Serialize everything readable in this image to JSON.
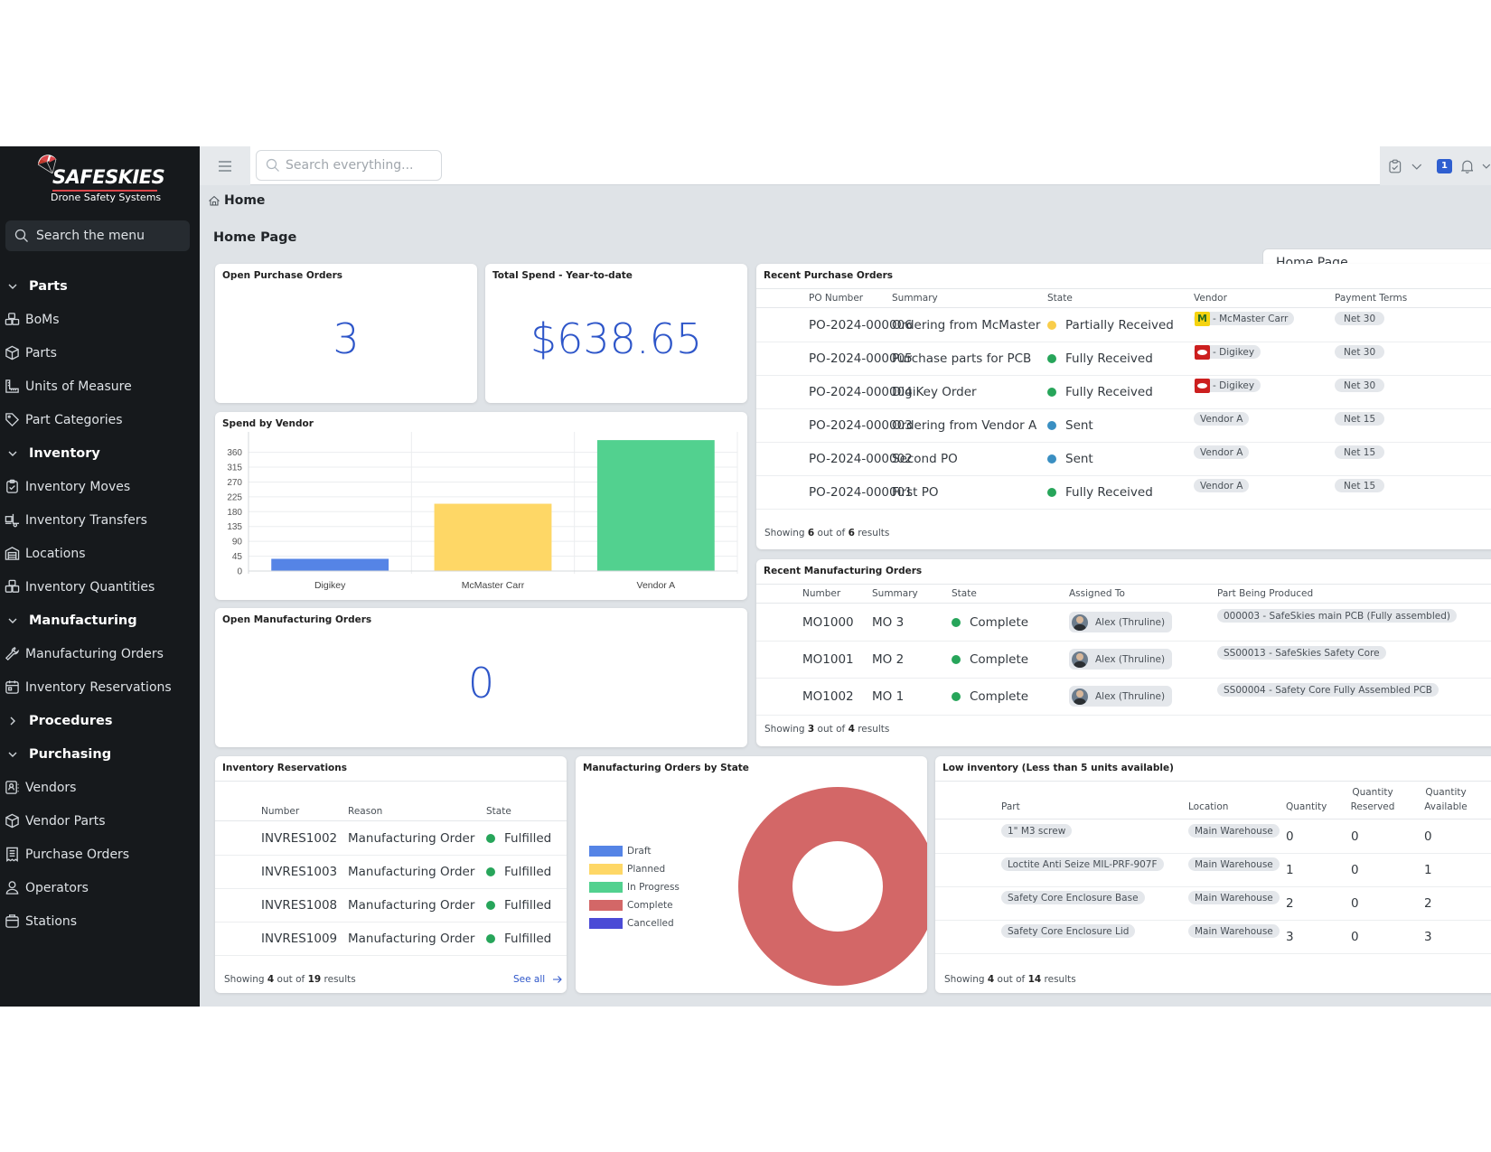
{
  "sidebar": {
    "brand_name": "SAFESKIES",
    "brand_tagline": "Drone Safety Systems",
    "search_placeholder": "Search the menu",
    "groups": [
      {
        "label": "Parts",
        "expanded": true,
        "items": [
          {
            "label": "BoMs",
            "icon": "boxes-icon"
          },
          {
            "label": "Parts",
            "icon": "cube-icon"
          },
          {
            "label": "Units of Measure",
            "icon": "ruler-icon"
          },
          {
            "label": "Part Categories",
            "icon": "tag-icon"
          }
        ]
      },
      {
        "label": "Inventory",
        "expanded": true,
        "items": [
          {
            "label": "Inventory Moves",
            "icon": "clipboard-check-icon"
          },
          {
            "label": "Inventory Transfers",
            "icon": "dolly-icon"
          },
          {
            "label": "Locations",
            "icon": "warehouse-icon"
          },
          {
            "label": "Inventory Quantities",
            "icon": "packages-icon"
          }
        ]
      },
      {
        "label": "Manufacturing",
        "expanded": true,
        "items": [
          {
            "label": "Manufacturing Orders",
            "icon": "wrench-icon"
          },
          {
            "label": "Inventory Reservations",
            "icon": "calendar-icon"
          }
        ]
      },
      {
        "label": "Procedures",
        "expanded": false,
        "items": []
      },
      {
        "label": "Purchasing",
        "expanded": true,
        "items": [
          {
            "label": "Vendors",
            "icon": "contact-book-icon"
          },
          {
            "label": "Vendor Parts",
            "icon": "cube-icon"
          },
          {
            "label": "Purchase Orders",
            "icon": "receipt-icon"
          },
          {
            "label": "Operators",
            "icon": "user-icon"
          },
          {
            "label": "Stations",
            "icon": "station-icon"
          }
        ]
      }
    ]
  },
  "header": {
    "search_placeholder": "Search everything...",
    "notification_count": "1"
  },
  "breadcrumb": {
    "label": "Home"
  },
  "page": {
    "title": "Home Page",
    "dashboard_select": "Home Page"
  },
  "colors": {
    "accent": "#2e56c9",
    "sidebar_bg": "#16191c",
    "state_green": "#27a55a",
    "state_yellow": "#f9cd4a",
    "state_blue": "#3a8fc2"
  },
  "kpis": {
    "open_po": {
      "title": "Open Purchase Orders",
      "value": "3"
    },
    "total_spend": {
      "title": "Total Spend - Year-to-date",
      "value": "$638.65"
    },
    "open_mo": {
      "title": "Open Manufacturing Orders",
      "value": "0"
    }
  },
  "spend_by_vendor": {
    "title": "Spend by Vendor"
  },
  "recent_pos": {
    "title": "Recent Purchase Orders",
    "columns": [
      "PO Number",
      "Summary",
      "State",
      "Vendor",
      "Payment Terms"
    ],
    "rows": [
      {
        "number": "PO-2024-000006",
        "summary": "Ordering from McMaster",
        "state": "Partially Received",
        "state_color": "#f9cd4a",
        "vendor": "- McMaster Carr",
        "vendor_logo": "mcmaster",
        "terms": "Net 30"
      },
      {
        "number": "PO-2024-000005",
        "summary": "Purchase parts for PCB",
        "state": "Fully Received",
        "state_color": "#27a55a",
        "vendor": "- Digikey",
        "vendor_logo": "digikey",
        "terms": "Net 30"
      },
      {
        "number": "PO-2024-000004",
        "summary": "DigiKey Order",
        "state": "Fully Received",
        "state_color": "#27a55a",
        "vendor": "- Digikey",
        "vendor_logo": "digikey",
        "terms": "Net 30"
      },
      {
        "number": "PO-2024-000003",
        "summary": "Ordering from Vendor A",
        "state": "Sent",
        "state_color": "#3a8fc2",
        "vendor": "Vendor A",
        "vendor_logo": "",
        "terms": "Net 15"
      },
      {
        "number": "PO-2024-000002",
        "summary": "Second PO",
        "state": "Sent",
        "state_color": "#3a8fc2",
        "vendor": "Vendor A",
        "vendor_logo": "",
        "terms": "Net 15"
      },
      {
        "number": "PO-2024-000001",
        "summary": "First PO",
        "state": "Fully Received",
        "state_color": "#27a55a",
        "vendor": "Vendor A",
        "vendor_logo": "",
        "terms": "Net 15"
      }
    ],
    "footer": {
      "prefix": "Showing ",
      "shown": "6",
      "middle": " out of ",
      "total": "6",
      "suffix": " results"
    }
  },
  "recent_mos": {
    "title": "Recent Manufacturing Orders",
    "columns": [
      "Number",
      "Summary",
      "State",
      "Assigned To",
      "Part Being Produced"
    ],
    "rows": [
      {
        "number": "MO1000",
        "summary": "MO 3",
        "state": "Complete",
        "assignee": "Alex (Thruline)",
        "part": "000003 - SafeSkies main PCB (Fully assembled)"
      },
      {
        "number": "MO1001",
        "summary": "MO 2",
        "state": "Complete",
        "assignee": "Alex (Thruline)",
        "part": "SS00013 - SafeSkies Safety Core"
      },
      {
        "number": "MO1002",
        "summary": "MO 1",
        "state": "Complete",
        "assignee": "Alex (Thruline)",
        "part": "SS00004 - Safety Core Fully Assembled PCB"
      }
    ],
    "footer": {
      "prefix": "Showing ",
      "shown": "3",
      "middle": " out of ",
      "total": "4",
      "suffix": " results"
    }
  },
  "inventory_reservations": {
    "title": "Inventory Reservations",
    "columns": [
      "Number",
      "Reason",
      "State"
    ],
    "rows": [
      {
        "number": "INVRES1002",
        "reason": "Manufacturing Order",
        "state": "Fulfilled"
      },
      {
        "number": "INVRES1003",
        "reason": "Manufacturing Order",
        "state": "Fulfilled"
      },
      {
        "number": "INVRES1008",
        "reason": "Manufacturing Order",
        "state": "Fulfilled"
      },
      {
        "number": "INVRES1009",
        "reason": "Manufacturing Order",
        "state": "Fulfilled"
      }
    ],
    "footer": {
      "prefix": "Showing ",
      "shown": "4",
      "middle": " out of ",
      "total": "19",
      "suffix": " results"
    },
    "see_all": "See all"
  },
  "mo_by_state": {
    "title": "Manufacturing Orders by State"
  },
  "low_inventory": {
    "title": "Low inventory (Less than 5 units available)",
    "columns": [
      "Part",
      "Location",
      "Quantity",
      "Quantity Reserved",
      "Quantity Available"
    ],
    "rows": [
      {
        "part": "1\" M3 screw",
        "location": "Main Warehouse",
        "qty": "0",
        "reserved": "0",
        "available": "0"
      },
      {
        "part": "Loctite Anti Seize MIL-PRF-907F",
        "location": "Main Warehouse",
        "qty": "1",
        "reserved": "0",
        "available": "1"
      },
      {
        "part": "Safety Core Enclosure Base",
        "location": "Main Warehouse",
        "qty": "2",
        "reserved": "0",
        "available": "2"
      },
      {
        "part": "Safety Core Enclosure Lid",
        "location": "Main Warehouse",
        "qty": "3",
        "reserved": "0",
        "available": "3"
      }
    ],
    "footer": {
      "prefix": "Showing ",
      "shown": "4",
      "middle": " out of ",
      "total": "14",
      "suffix": " results"
    }
  },
  "chart_data": [
    {
      "type": "bar",
      "title": "Spend by Vendor",
      "categories": [
        "Digikey",
        "McMaster Carr",
        "Vendor A"
      ],
      "values": [
        37,
        204,
        397
      ],
      "colors": [
        "#5584e6",
        "#fed766",
        "#52d18f"
      ],
      "xlabel": "",
      "ylabel": "",
      "ylim": [
        0,
        400
      ],
      "yticks": [
        0,
        45,
        90,
        135,
        180,
        225,
        270,
        315,
        360
      ],
      "grid": true,
      "legend": "none"
    },
    {
      "type": "pie",
      "title": "Manufacturing Orders by State",
      "donut": true,
      "categories": [
        "Draft",
        "Planned",
        "In Progress",
        "Complete",
        "Cancelled"
      ],
      "values": [
        0,
        0,
        0,
        3,
        0
      ],
      "colors": [
        "#5584e6",
        "#fed766",
        "#52d18f",
        "#d36767",
        "#4b4bd6"
      ],
      "legend": "left"
    }
  ]
}
